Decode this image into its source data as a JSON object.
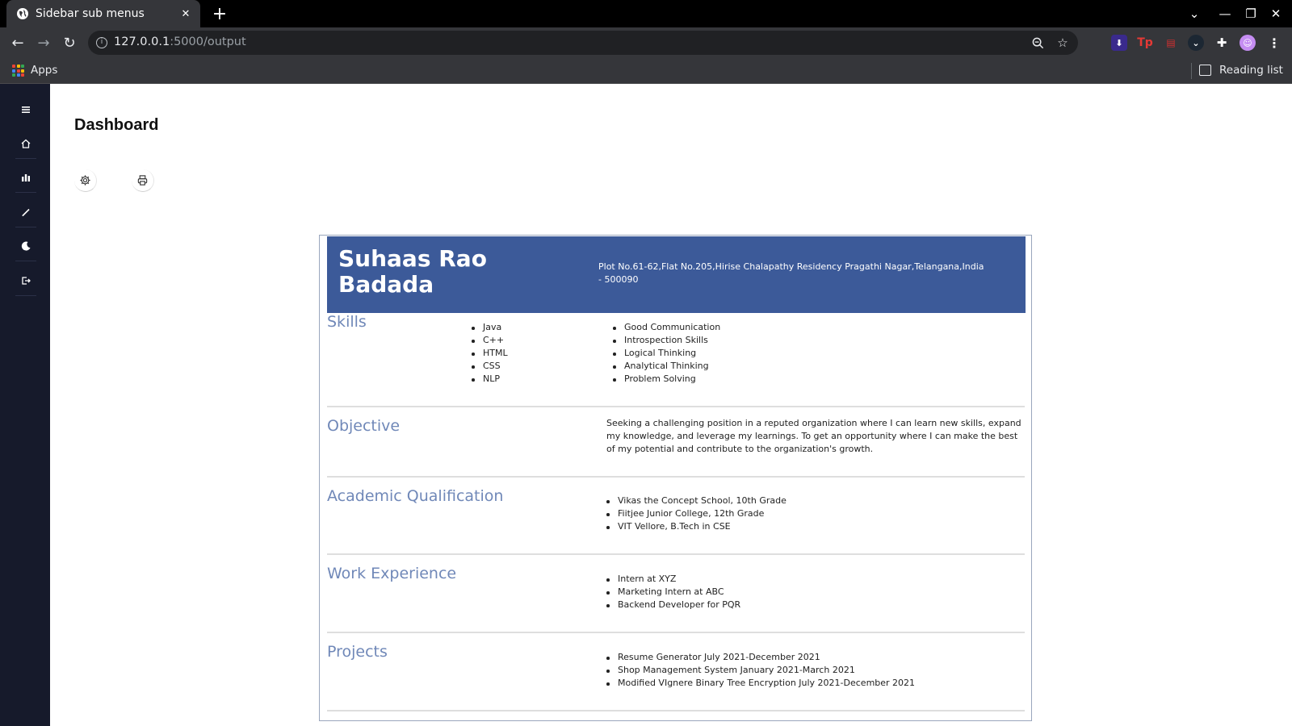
{
  "browser": {
    "tab_title": "Sidebar sub menus",
    "url_host": "127.0.0.1",
    "url_path": ":5000/output",
    "bookmarks_apps": "Apps",
    "reading_list": "Reading list"
  },
  "app": {
    "page_title": "Dashboard",
    "sidebar_icons": [
      "menu-icon",
      "home-icon",
      "chart-icon",
      "pencil-icon",
      "moon-icon",
      "logout-icon"
    ],
    "tools": [
      "gear-icon",
      "printer-icon"
    ]
  },
  "resume": {
    "name": "Suhaas Rao Badada",
    "address": "Plot No.61-62,Flat No.205,Hirise Chalapathy Residency Pragathi Nagar,Telangana,India - 500090",
    "header_color": "#3c5a99",
    "section_color": "#7088b8",
    "skills": {
      "title": "Skills",
      "technical": [
        "Java",
        "C++",
        "HTML",
        "CSS",
        "NLP"
      ],
      "soft": [
        "Good Communication",
        "Introspection Skills",
        "Logical Thinking",
        "Analytical Thinking",
        "Problem Solving"
      ]
    },
    "objective": {
      "title": "Objective",
      "text": "Seeking a challenging position in a reputed organization where I can learn new skills, expand my knowledge, and leverage my learnings. To get an opportunity where I can make the best of my potential and contribute to the organization's growth."
    },
    "academic": {
      "title": "Academic Qualification",
      "items": [
        "Vikas the Concept School, 10th Grade",
        "Fiitjee Junior College, 12th Grade",
        "VIT Vellore, B.Tech in CSE"
      ]
    },
    "work": {
      "title": "Work Experience",
      "items": [
        "Intern at XYZ",
        "Marketing Intern at ABC",
        "Backend Developer for PQR"
      ]
    },
    "projects": {
      "title": "Projects",
      "items": [
        "Resume Generator July 2021-December 2021",
        "Shop Management System January 2021-March 2021",
        "Modified VIgnere Binary Tree Encryption July 2021-December 2021"
      ]
    }
  }
}
